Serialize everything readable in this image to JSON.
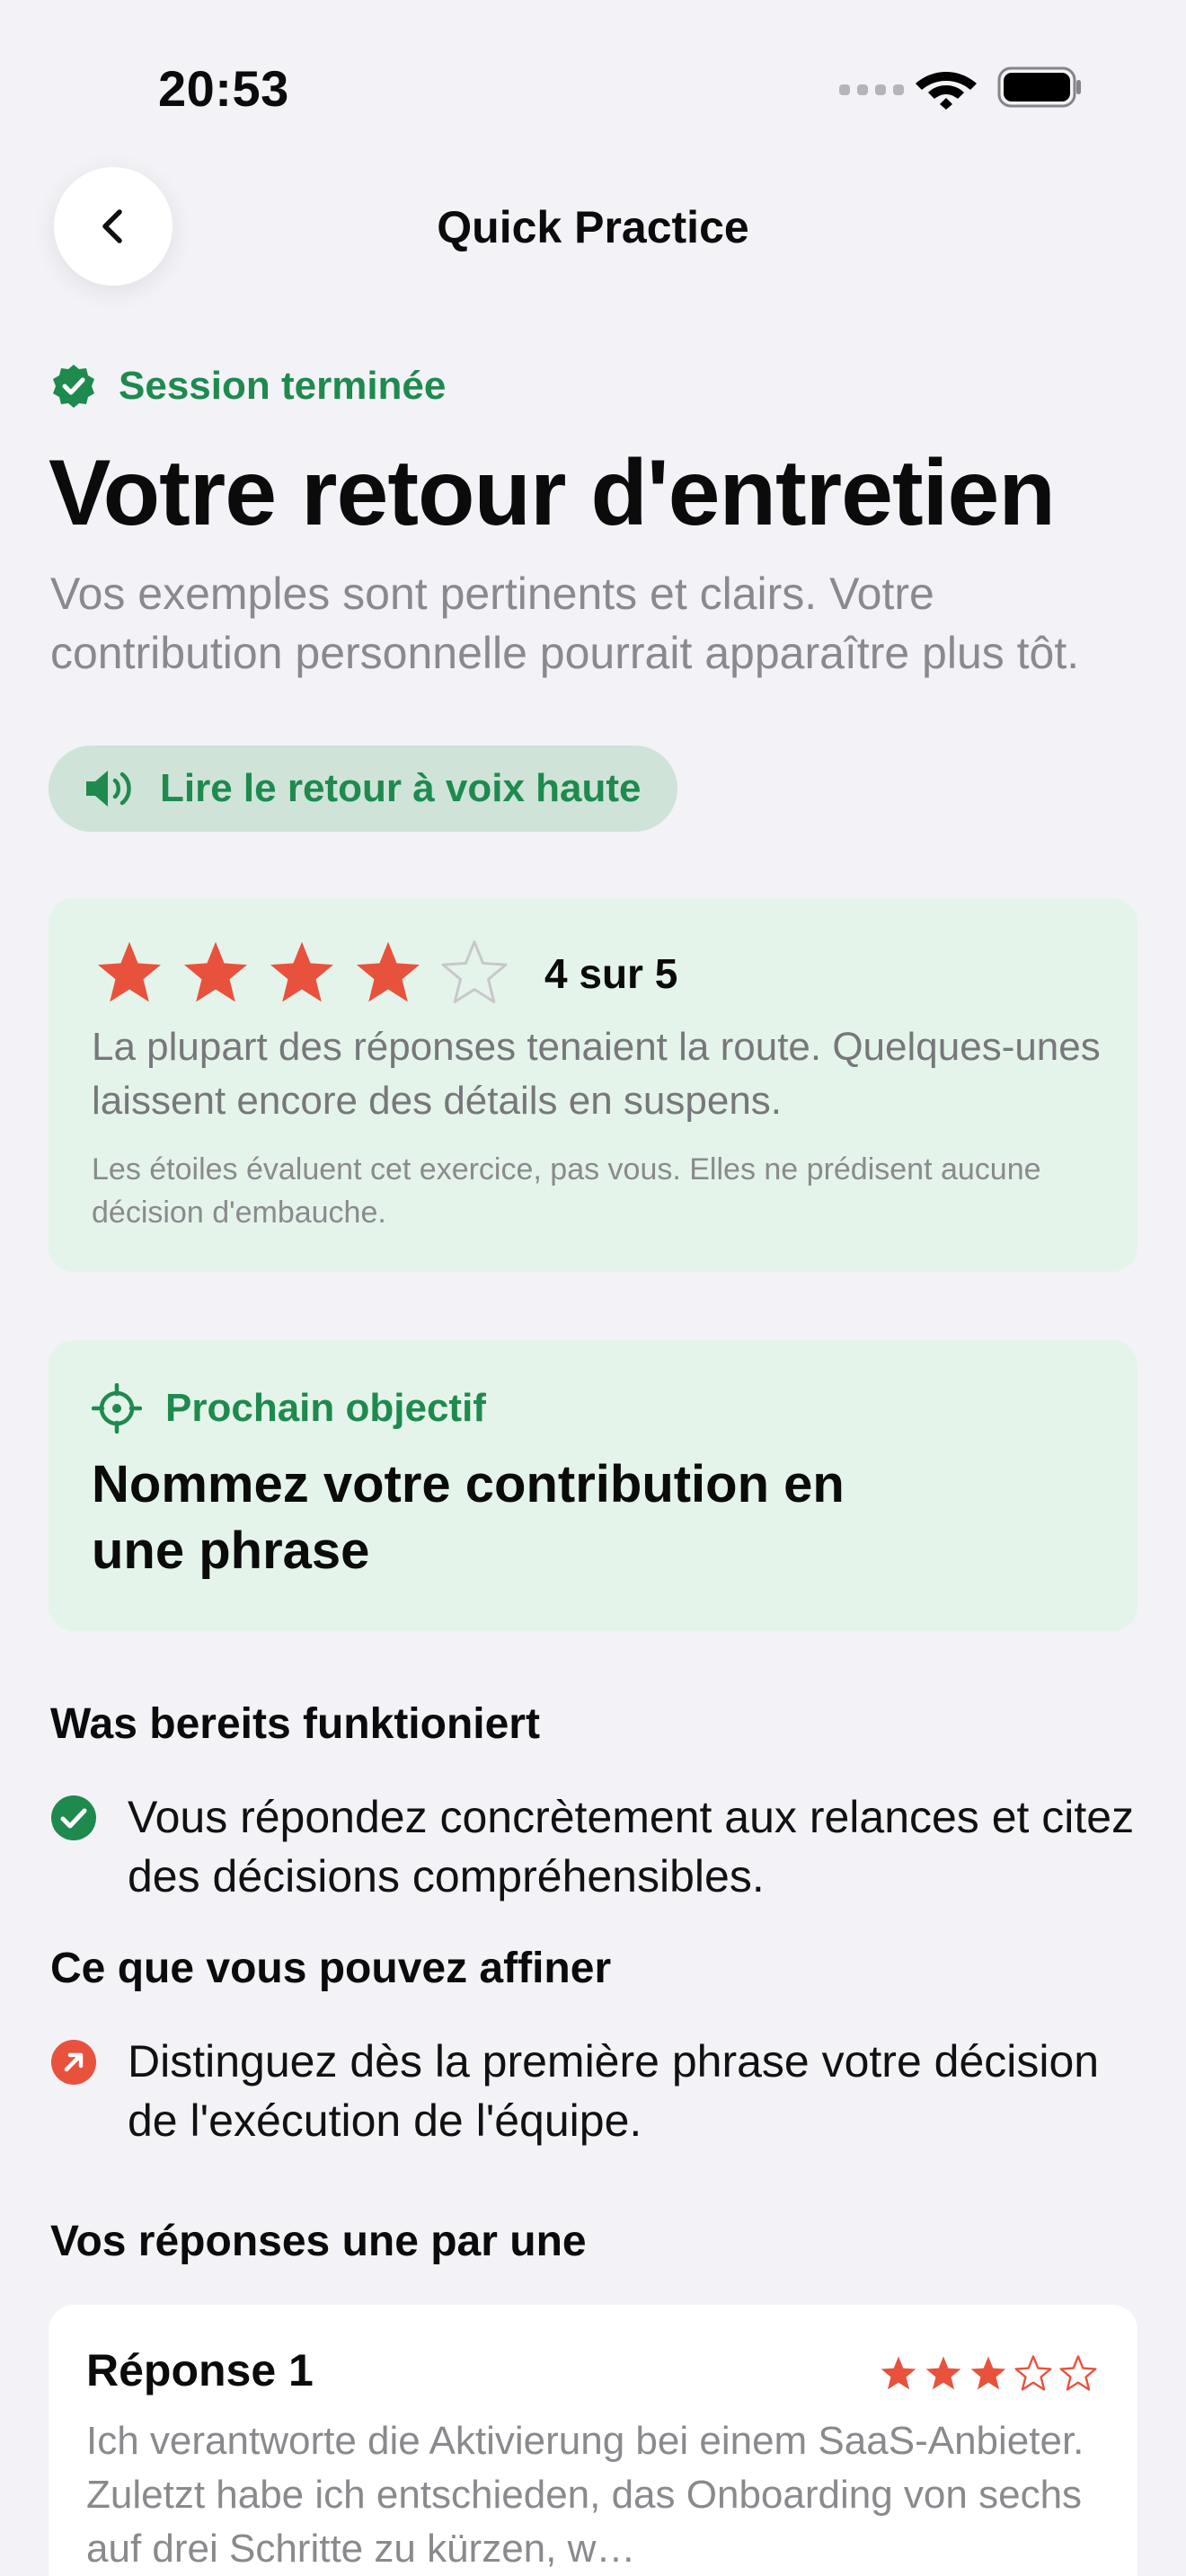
{
  "status_bar": {
    "time": "20:53"
  },
  "nav": {
    "title": "Quick Practice"
  },
  "header": {
    "session_label": "Session terminée",
    "title": "Votre retour d'entretien",
    "summary": "Vos exemples sont pertinents et clairs. Votre contribution personnelle pourrait apparaître plus tôt.",
    "read_aloud_label": "Lire le retour à voix haute"
  },
  "rating": {
    "value": 4,
    "max": 5,
    "label": "4 sur 5",
    "description": "La plupart des réponses tenaient la route. Quelques-unes laissent encore des détails en suspens.",
    "note": "Les étoiles évaluent cet exercice, pas vous. Elles ne prédisent aucune décision d'embauche."
  },
  "goal": {
    "label": "Prochain objectif",
    "text": "Nommez votre contribution en une phrase"
  },
  "strengths": {
    "heading": "Was bereits funktioniert",
    "items": [
      "Vous répondez concrètement aux relances et citez des décisions compréhensibles."
    ]
  },
  "improvements": {
    "heading": "Ce que vous pouvez affiner",
    "items": [
      "Distinguez dès la première phrase votre décision de l'exécution de l'équipe."
    ]
  },
  "answers": {
    "heading": "Vos réponses une par une",
    "items": [
      {
        "title": "Réponse 1",
        "rating": 3,
        "max": 5,
        "text": "Ich verantworte die Aktivierung bei einem SaaS-Anbieter. Zuletzt habe ich entschieden, das Onboarding von sechs auf drei Schritte zu kürzen, w…"
      }
    ]
  },
  "colors": {
    "accent_green": "#1e8a4e",
    "star_red": "#e8523d",
    "card_green": "#e5f4ea",
    "background": "#f2f2f7"
  }
}
